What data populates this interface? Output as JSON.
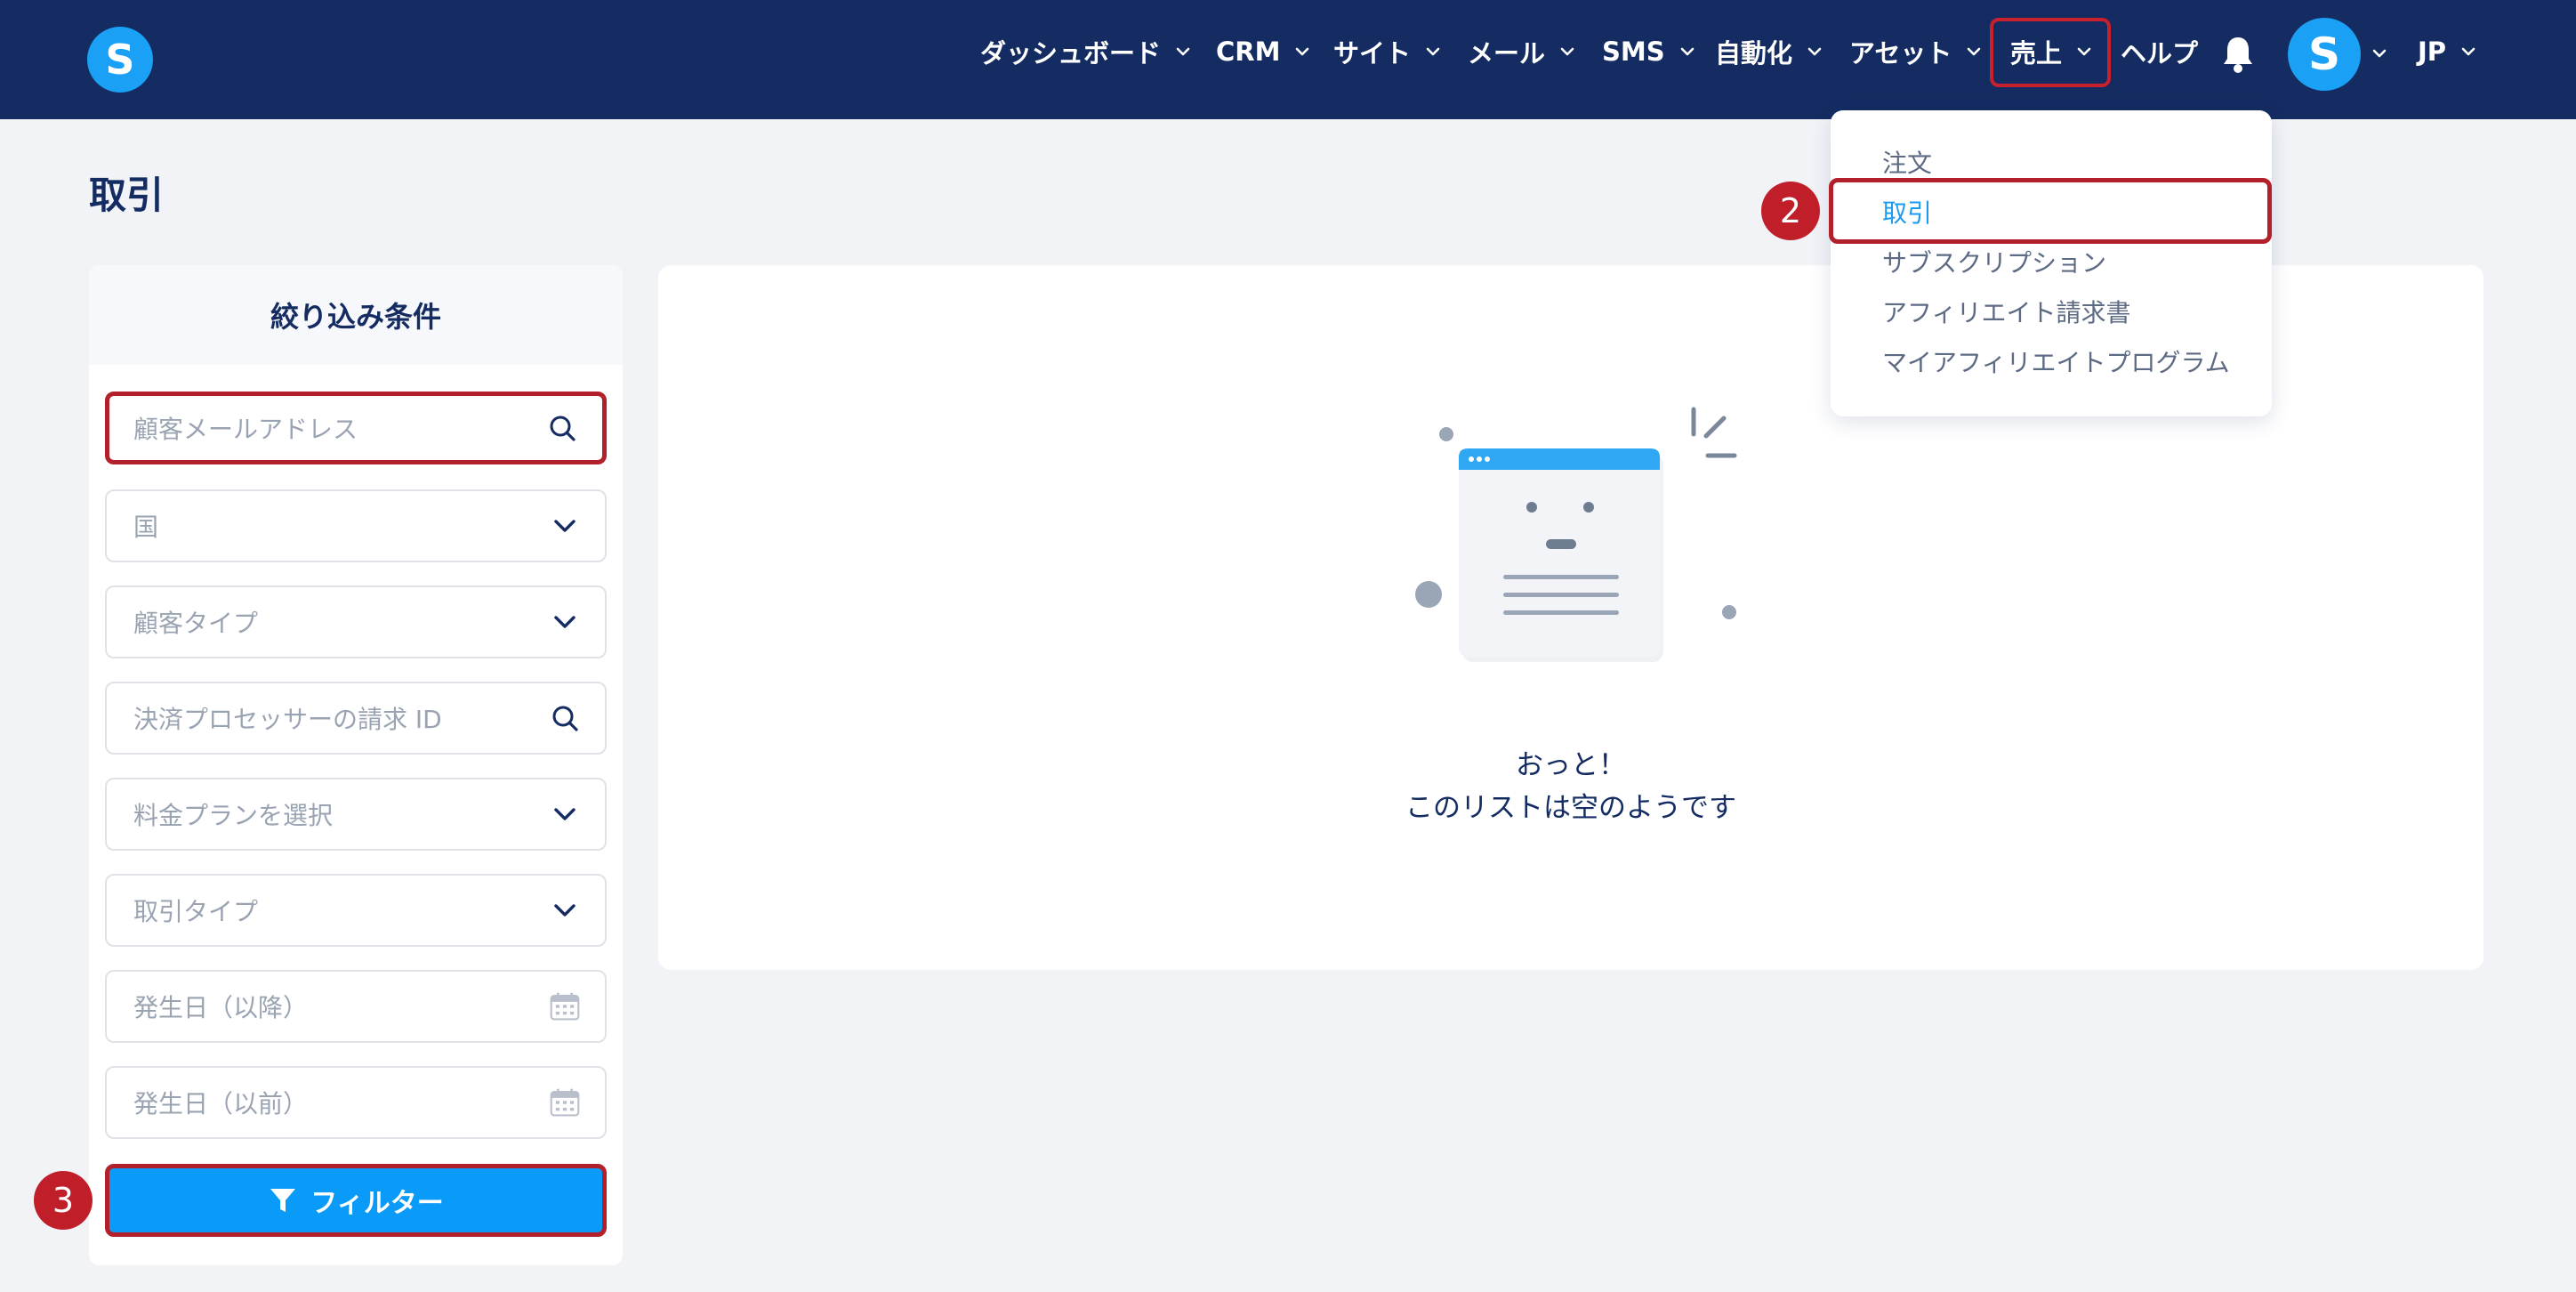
{
  "brand": {
    "logo_letter": "S",
    "accent": "#1aa0f5",
    "nav_bg": "#142c61",
    "highlight": "#b2212b"
  },
  "nav": {
    "items": [
      {
        "label": "ダッシュボード"
      },
      {
        "label": "CRM"
      },
      {
        "label": "サイト"
      },
      {
        "label": "メール"
      },
      {
        "label": "SMS"
      },
      {
        "label": "自動化"
      },
      {
        "label": "アセット"
      },
      {
        "label": "売上"
      },
      {
        "label": "ヘルプ"
      }
    ],
    "avatar_letter": "S",
    "language": "JP"
  },
  "page": {
    "title": "取引"
  },
  "filters": {
    "heading": "絞り込み条件",
    "fields": [
      {
        "placeholder": "顧客メールアドレス",
        "icon": "search-icon"
      },
      {
        "placeholder": "国",
        "icon": "chevron-down-icon"
      },
      {
        "placeholder": "顧客タイプ",
        "icon": "chevron-down-icon"
      },
      {
        "placeholder": "決済プロセッサーの請求 ID",
        "icon": "search-icon"
      },
      {
        "placeholder": "料金プランを選択",
        "icon": "chevron-down-icon"
      },
      {
        "placeholder": "取引タイプ",
        "icon": "chevron-down-icon"
      },
      {
        "placeholder": "発生日（以降）",
        "icon": "calendar-icon"
      },
      {
        "placeholder": "発生日（以前）",
        "icon": "calendar-icon"
      }
    ],
    "button_label": "フィルター"
  },
  "empty_state": {
    "title": "おっと！",
    "subtitle": "このリストは空のようです"
  },
  "sales_menu": {
    "items": [
      {
        "label": "注文"
      },
      {
        "label": "取引"
      },
      {
        "label": "サブスクリプション"
      },
      {
        "label": "アフィリエイト請求書"
      },
      {
        "label": "マイアフィリエイトプログラム"
      }
    ],
    "active": "取引"
  },
  "steps": {
    "menu_step": "2",
    "filter_step": "3"
  }
}
